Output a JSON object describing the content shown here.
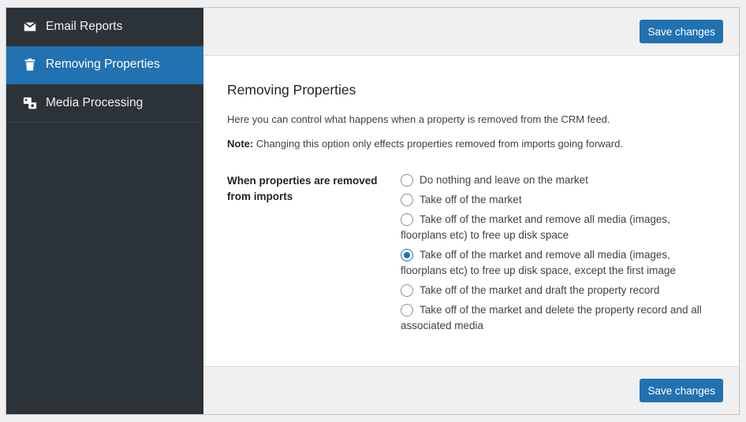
{
  "sidebar": {
    "items": [
      {
        "label": "Email Reports",
        "icon": "envelope-icon",
        "active": false
      },
      {
        "label": "Removing Properties",
        "icon": "trash-icon",
        "active": true
      },
      {
        "label": "Media Processing",
        "icon": "images-icon",
        "active": false
      }
    ]
  },
  "toolbar": {
    "save_label_top": "Save changes",
    "save_label_bottom": "Save changes"
  },
  "section": {
    "title": "Removing Properties",
    "description": "Here you can control what happens when a property is removed from the CRM feed.",
    "note_label": "Note:",
    "note_text": " Changing this option only effects properties removed from imports going forward."
  },
  "field": {
    "label": "When properties are removed from imports",
    "options": [
      {
        "label": "Do nothing and leave on the market",
        "checked": false
      },
      {
        "label": "Take off of the market",
        "checked": false
      },
      {
        "label": "Take off of the market and remove all media (images, floorplans etc) to free up disk space",
        "checked": false
      },
      {
        "label": "Take off of the market and remove all media (images, floorplans etc) to free up disk space, except the first image",
        "checked": true
      },
      {
        "label": "Take off of the market and draft the property record",
        "checked": false
      },
      {
        "label": "Take off of the market and delete the property record and all associated media",
        "checked": false
      }
    ]
  },
  "colors": {
    "sidebar_bg": "#2c3338",
    "accent": "#2271b1"
  }
}
